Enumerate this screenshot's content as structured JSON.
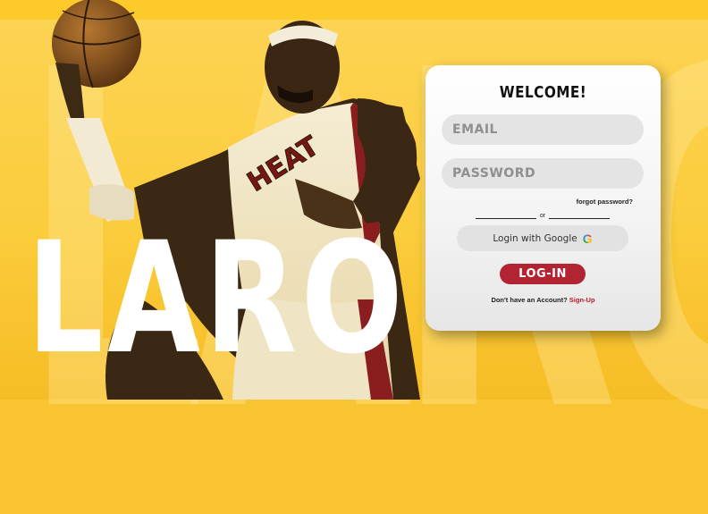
{
  "brand": {
    "name": "LARO"
  },
  "login": {
    "title": "WELCOME!",
    "email": {
      "placeholder": "EMAIL",
      "value": ""
    },
    "password": {
      "placeholder": "PASSWORD",
      "value": ""
    },
    "forgot_label": "forgot password?",
    "divider_label": "or",
    "google_label": "Login with Google",
    "google_icon": "google-g-icon",
    "login_label": "LOG-IN",
    "signup_prompt": "Don't have an Account?",
    "signup_link": "Sign-Up"
  },
  "colors": {
    "background": "#f9c431",
    "accent_red": "#b32432",
    "card": "#ffffff",
    "field": "#e4e4e4"
  }
}
